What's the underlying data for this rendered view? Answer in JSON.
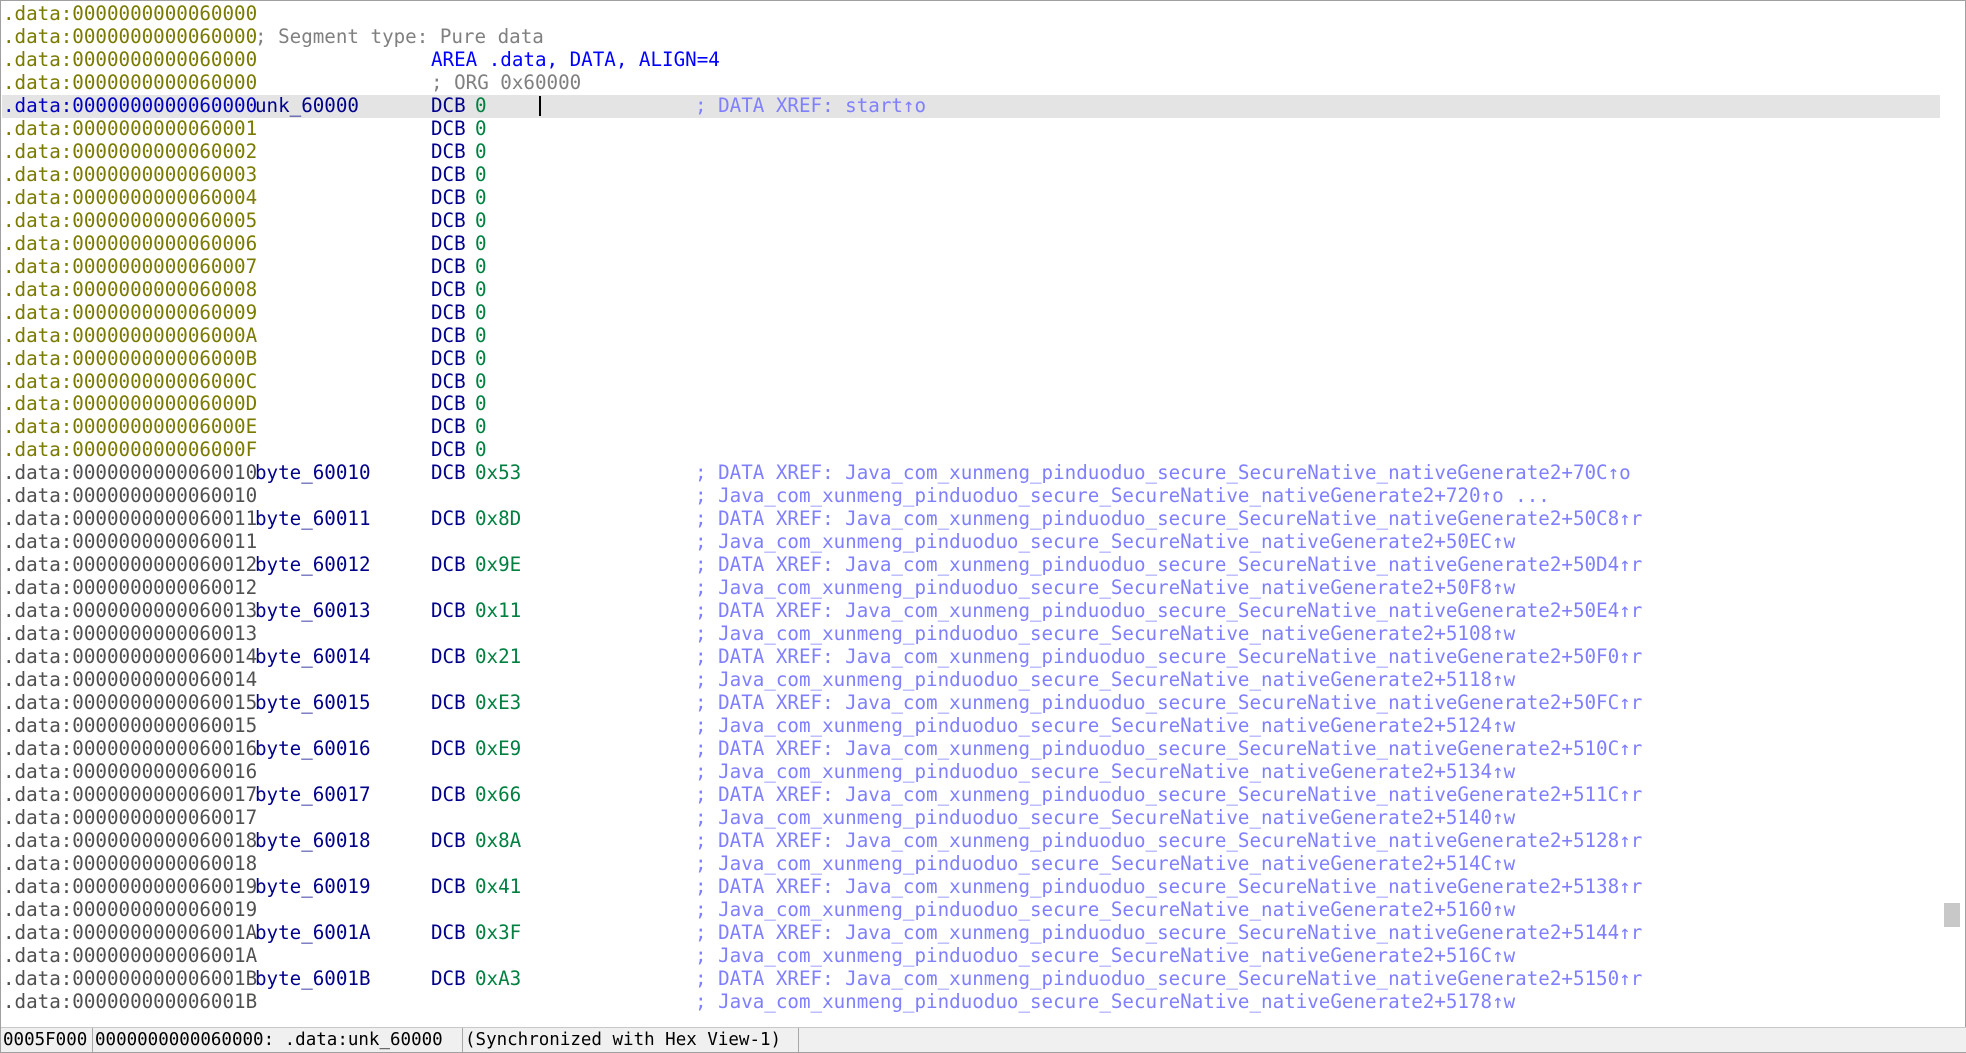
{
  "rows": [
    {
      "addr": ".data:0000000000060000",
      "kind": "plain"
    },
    {
      "addr": ".data:0000000000060000",
      "kind": "segcomment",
      "text": "; Segment type: Pure data"
    },
    {
      "addr": ".data:0000000000060000",
      "kind": "area",
      "text": "AREA .data, DATA, ALIGN=4"
    },
    {
      "addr": ".data:0000000000060000",
      "kind": "org",
      "text": "; ORG 0x60000"
    },
    {
      "addr": ".data:0000000000060000",
      "kind": "data",
      "label": "unk_60000",
      "op": "DCB",
      "val": "0",
      "cmt": "; DATA XREF: start↑o",
      "current": true
    },
    {
      "addr": ".data:0000000000060001",
      "kind": "data",
      "op": "DCB",
      "val": "0"
    },
    {
      "addr": ".data:0000000000060002",
      "kind": "data",
      "op": "DCB",
      "val": "0"
    },
    {
      "addr": ".data:0000000000060003",
      "kind": "data",
      "op": "DCB",
      "val": "0"
    },
    {
      "addr": ".data:0000000000060004",
      "kind": "data",
      "op": "DCB",
      "val": "0"
    },
    {
      "addr": ".data:0000000000060005",
      "kind": "data",
      "op": "DCB",
      "val": "0"
    },
    {
      "addr": ".data:0000000000060006",
      "kind": "data",
      "op": "DCB",
      "val": "0"
    },
    {
      "addr": ".data:0000000000060007",
      "kind": "data",
      "op": "DCB",
      "val": "0"
    },
    {
      "addr": ".data:0000000000060008",
      "kind": "data",
      "op": "DCB",
      "val": "0"
    },
    {
      "addr": ".data:0000000000060009",
      "kind": "data",
      "op": "DCB",
      "val": "0"
    },
    {
      "addr": ".data:000000000006000A",
      "kind": "data",
      "op": "DCB",
      "val": "0"
    },
    {
      "addr": ".data:000000000006000B",
      "kind": "data",
      "op": "DCB",
      "val": "0"
    },
    {
      "addr": ".data:000000000006000C",
      "kind": "data",
      "op": "DCB",
      "val": "0"
    },
    {
      "addr": ".data:000000000006000D",
      "kind": "data",
      "op": "DCB",
      "val": "0"
    },
    {
      "addr": ".data:000000000006000E",
      "kind": "data",
      "op": "DCB",
      "val": "0"
    },
    {
      "addr": ".data:000000000006000F",
      "kind": "data",
      "op": "DCB",
      "val": "0"
    },
    {
      "addr": ".data:0000000000060010",
      "kind": "data",
      "grey": true,
      "label": "byte_60010",
      "op": "DCB",
      "val": "0x53",
      "cmt": "; DATA XREF: Java_com_xunmeng_pinduoduo_secure_SecureNative_nativeGenerate2+70C↑o"
    },
    {
      "addr": ".data:0000000000060010",
      "kind": "data",
      "grey": true,
      "cmt": "; Java_com_xunmeng_pinduoduo_secure_SecureNative_nativeGenerate2+720↑o ..."
    },
    {
      "addr": ".data:0000000000060011",
      "kind": "data",
      "grey": true,
      "label": "byte_60011",
      "op": "DCB",
      "val": "0x8D",
      "cmt": "; DATA XREF: Java_com_xunmeng_pinduoduo_secure_SecureNative_nativeGenerate2+50C8↑r"
    },
    {
      "addr": ".data:0000000000060011",
      "kind": "data",
      "grey": true,
      "cmt": "; Java_com_xunmeng_pinduoduo_secure_SecureNative_nativeGenerate2+50EC↑w"
    },
    {
      "addr": ".data:0000000000060012",
      "kind": "data",
      "grey": true,
      "label": "byte_60012",
      "op": "DCB",
      "val": "0x9E",
      "cmt": "; DATA XREF: Java_com_xunmeng_pinduoduo_secure_SecureNative_nativeGenerate2+50D4↑r"
    },
    {
      "addr": ".data:0000000000060012",
      "kind": "data",
      "grey": true,
      "cmt": "; Java_com_xunmeng_pinduoduo_secure_SecureNative_nativeGenerate2+50F8↑w"
    },
    {
      "addr": ".data:0000000000060013",
      "kind": "data",
      "grey": true,
      "label": "byte_60013",
      "op": "DCB",
      "val": "0x11",
      "cmt": "; DATA XREF: Java_com_xunmeng_pinduoduo_secure_SecureNative_nativeGenerate2+50E4↑r"
    },
    {
      "addr": ".data:0000000000060013",
      "kind": "data",
      "grey": true,
      "cmt": "; Java_com_xunmeng_pinduoduo_secure_SecureNative_nativeGenerate2+5108↑w"
    },
    {
      "addr": ".data:0000000000060014",
      "kind": "data",
      "grey": true,
      "label": "byte_60014",
      "op": "DCB",
      "val": "0x21",
      "cmt": "; DATA XREF: Java_com_xunmeng_pinduoduo_secure_SecureNative_nativeGenerate2+50F0↑r"
    },
    {
      "addr": ".data:0000000000060014",
      "kind": "data",
      "grey": true,
      "cmt": "; Java_com_xunmeng_pinduoduo_secure_SecureNative_nativeGenerate2+5118↑w"
    },
    {
      "addr": ".data:0000000000060015",
      "kind": "data",
      "grey": true,
      "label": "byte_60015",
      "op": "DCB",
      "val": "0xE3",
      "cmt": "; DATA XREF: Java_com_xunmeng_pinduoduo_secure_SecureNative_nativeGenerate2+50FC↑r"
    },
    {
      "addr": ".data:0000000000060015",
      "kind": "data",
      "grey": true,
      "cmt": "; Java_com_xunmeng_pinduoduo_secure_SecureNative_nativeGenerate2+5124↑w"
    },
    {
      "addr": ".data:0000000000060016",
      "kind": "data",
      "grey": true,
      "label": "byte_60016",
      "op": "DCB",
      "val": "0xE9",
      "cmt": "; DATA XREF: Java_com_xunmeng_pinduoduo_secure_SecureNative_nativeGenerate2+510C↑r"
    },
    {
      "addr": ".data:0000000000060016",
      "kind": "data",
      "grey": true,
      "cmt": "; Java_com_xunmeng_pinduoduo_secure_SecureNative_nativeGenerate2+5134↑w"
    },
    {
      "addr": ".data:0000000000060017",
      "kind": "data",
      "grey": true,
      "label": "byte_60017",
      "op": "DCB",
      "val": "0x66",
      "cmt": "; DATA XREF: Java_com_xunmeng_pinduoduo_secure_SecureNative_nativeGenerate2+511C↑r"
    },
    {
      "addr": ".data:0000000000060017",
      "kind": "data",
      "grey": true,
      "cmt": "; Java_com_xunmeng_pinduoduo_secure_SecureNative_nativeGenerate2+5140↑w"
    },
    {
      "addr": ".data:0000000000060018",
      "kind": "data",
      "grey": true,
      "label": "byte_60018",
      "op": "DCB",
      "val": "0x8A",
      "cmt": "; DATA XREF: Java_com_xunmeng_pinduoduo_secure_SecureNative_nativeGenerate2+5128↑r"
    },
    {
      "addr": ".data:0000000000060018",
      "kind": "data",
      "grey": true,
      "cmt": "; Java_com_xunmeng_pinduoduo_secure_SecureNative_nativeGenerate2+514C↑w"
    },
    {
      "addr": ".data:0000000000060019",
      "kind": "data",
      "grey": true,
      "label": "byte_60019",
      "op": "DCB",
      "val": "0x41",
      "cmt": "; DATA XREF: Java_com_xunmeng_pinduoduo_secure_SecureNative_nativeGenerate2+5138↑r"
    },
    {
      "addr": ".data:0000000000060019",
      "kind": "data",
      "grey": true,
      "cmt": "; Java_com_xunmeng_pinduoduo_secure_SecureNative_nativeGenerate2+5160↑w"
    },
    {
      "addr": ".data:000000000006001A",
      "kind": "data",
      "grey": true,
      "label": "byte_6001A",
      "op": "DCB",
      "val": "0x3F",
      "cmt": "; DATA XREF: Java_com_xunmeng_pinduoduo_secure_SecureNative_nativeGenerate2+5144↑r"
    },
    {
      "addr": ".data:000000000006001A",
      "kind": "data",
      "grey": true,
      "cmt": "; Java_com_xunmeng_pinduoduo_secure_SecureNative_nativeGenerate2+516C↑w"
    },
    {
      "addr": ".data:000000000006001B",
      "kind": "data",
      "grey": true,
      "label": "byte_6001B",
      "op": "DCB",
      "val": "0xA3",
      "cmt": "; DATA XREF: Java_com_xunmeng_pinduoduo_secure_SecureNative_nativeGenerate2+5150↑r"
    },
    {
      "addr": ".data:000000000006001B",
      "kind": "data",
      "grey": true,
      "cmt": "; Java_com_xunmeng_pinduoduo_secure_SecureNative_nativeGenerate2+5178↑w"
    }
  ],
  "status": {
    "offset": "0005F000",
    "location": "0000000000060000: .data:unk_60000",
    "sync": "(Synchronized with Hex View-1)"
  },
  "scroll_position": 0.9
}
